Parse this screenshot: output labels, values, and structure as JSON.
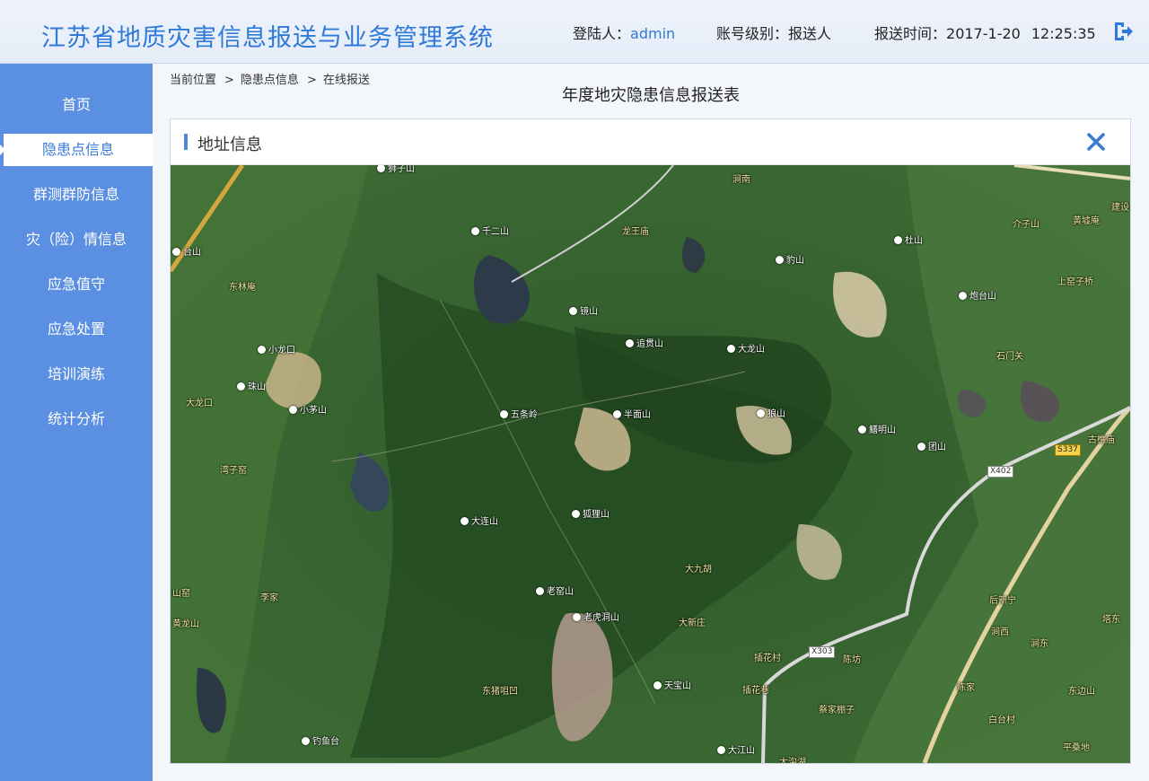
{
  "header": {
    "title": "江苏省地质灾害信息报送与业务管理系统",
    "user_label": "登陆人：",
    "user_value": "admin",
    "level_label": "账号级别：",
    "level_value": "报送人",
    "time_label": "报送时间：",
    "date_value": "2017-1-20",
    "time_value": "12:25:35"
  },
  "sidebar": {
    "items": [
      {
        "label": "首页"
      },
      {
        "label": "隐患点信息"
      },
      {
        "label": "群测群防信息"
      },
      {
        "label": "灾（险）情信息"
      },
      {
        "label": "应急值守"
      },
      {
        "label": "应急处置"
      },
      {
        "label": "培训演练"
      },
      {
        "label": "统计分析"
      }
    ],
    "active_index": 1
  },
  "breadcrumb": {
    "items": [
      "当前位置",
      "隐患点信息",
      "在线报送"
    ],
    "separator": ">"
  },
  "page_title": "年度地灾隐患信息报送表",
  "panel": {
    "title": "地址信息"
  },
  "map": {
    "mountains": [
      {
        "name": "千二山"
      },
      {
        "name": "台山"
      },
      {
        "name": "镜山"
      },
      {
        "name": "追贯山"
      },
      {
        "name": "大龙山"
      },
      {
        "name": "豹山"
      },
      {
        "name": "杜山"
      },
      {
        "name": "炮台山"
      },
      {
        "name": "小龙口"
      },
      {
        "name": "珠山"
      },
      {
        "name": "小茅山"
      },
      {
        "name": "五条岭"
      },
      {
        "name": "半面山"
      },
      {
        "name": "狼山"
      },
      {
        "name": "鳝明山"
      },
      {
        "name": "团山"
      },
      {
        "name": "大连山"
      },
      {
        "name": "狐狸山"
      },
      {
        "name": "老窑山"
      },
      {
        "name": "老虎洞山"
      },
      {
        "name": "天宝山"
      },
      {
        "name": "钓鱼台"
      },
      {
        "name": "大江山"
      },
      {
        "name": "狮子山"
      }
    ],
    "villages": [
      {
        "name": "涧南"
      },
      {
        "name": "龙王庙"
      },
      {
        "name": "介子山"
      },
      {
        "name": "黄墟庵"
      },
      {
        "name": "建设"
      },
      {
        "name": "上窑子桥"
      },
      {
        "name": "东林庵"
      },
      {
        "name": "石门关"
      },
      {
        "name": "大龙口"
      },
      {
        "name": "古樵庙"
      },
      {
        "name": "湾子窑"
      },
      {
        "name": "大九胡"
      },
      {
        "name": "李家"
      },
      {
        "name": "山窑"
      },
      {
        "name": "黄龙山"
      },
      {
        "name": "大新庄"
      },
      {
        "name": "后新宁"
      },
      {
        "name": "塔东"
      },
      {
        "name": "涧西"
      },
      {
        "name": "涧东"
      },
      {
        "name": "插花村"
      },
      {
        "name": "陈坊"
      },
      {
        "name": "东猪咀凹"
      },
      {
        "name": "插花巷"
      },
      {
        "name": "蔡家棚子"
      },
      {
        "name": "陈家"
      },
      {
        "name": "东边山"
      },
      {
        "name": "白台村"
      },
      {
        "name": "平桑地"
      },
      {
        "name": "大沟湖"
      }
    ],
    "road_signs": [
      {
        "name": "S337",
        "style": "yellow"
      },
      {
        "name": "X402",
        "style": "white"
      },
      {
        "name": "X303",
        "style": "white"
      }
    ]
  }
}
